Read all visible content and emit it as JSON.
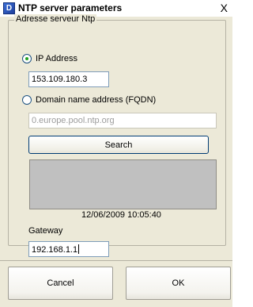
{
  "window": {
    "title": "NTP server parameters",
    "icon_glyph": "D",
    "close_glyph": "X"
  },
  "group": {
    "legend": "Adresse serveur Ntp"
  },
  "ip_option": {
    "label": "IP Address",
    "checked": true,
    "value": "153.109.180.3"
  },
  "fqdn_option": {
    "label": "Domain name address (FQDN)",
    "checked": false,
    "value": "0.europe.pool.ntp.org"
  },
  "search_button": {
    "label": "Search"
  },
  "datetime": "12/06/2009 10:05:40",
  "gateway": {
    "label": "Gateway",
    "value": "192.168.1.1"
  },
  "buttons": {
    "cancel": "Cancel",
    "ok": "OK"
  }
}
